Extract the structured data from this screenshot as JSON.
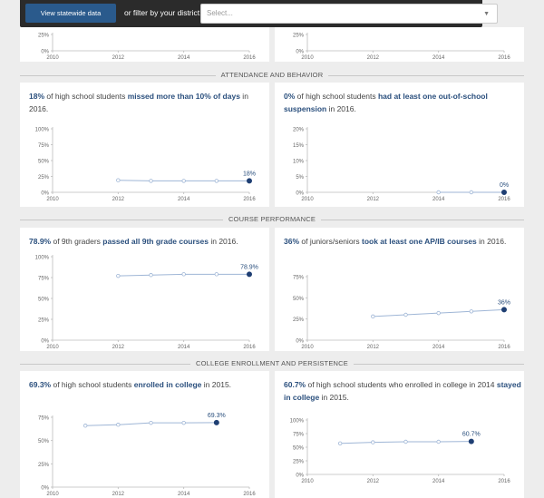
{
  "topbar": {
    "statewide_button": "View statewide data",
    "filter_label": "or filter by your district:",
    "district_placeholder": "Select..."
  },
  "sections": [
    {
      "title": "ATTENDANCE AND BEHAVIOR"
    },
    {
      "title": "COURSE PERFORMANCE"
    },
    {
      "title": "COLLEGE ENROLLMENT AND PERSISTENCE"
    }
  ],
  "cards": [
    {
      "id": "top-left-partial",
      "headline": []
    },
    {
      "id": "top-right-partial",
      "headline": []
    },
    {
      "id": "chronic-absence",
      "headline": [
        {
          "t": "18%",
          "h": true
        },
        {
          "t": " of high school students ",
          "h": false
        },
        {
          "t": "missed more than 10% of days",
          "h": true
        },
        {
          "t": " in 2016.",
          "h": false
        }
      ]
    },
    {
      "id": "suspension",
      "headline": [
        {
          "t": "0%",
          "h": true
        },
        {
          "t": " of high school students ",
          "h": false
        },
        {
          "t": "had at least one out-of-school suspension",
          "h": true
        },
        {
          "t": " in 2016.",
          "h": false
        }
      ]
    },
    {
      "id": "ninth-grade",
      "headline": [
        {
          "t": "78.9%",
          "h": true
        },
        {
          "t": " of 9th graders ",
          "h": false
        },
        {
          "t": "passed all 9th grade courses",
          "h": true
        },
        {
          "t": " in 2016.",
          "h": false
        }
      ]
    },
    {
      "id": "ap-ib",
      "headline": [
        {
          "t": "36%",
          "h": true
        },
        {
          "t": " of juniors/seniors ",
          "h": false
        },
        {
          "t": "took at least one AP/IB courses",
          "h": true
        },
        {
          "t": " in 2016.",
          "h": false
        }
      ]
    },
    {
      "id": "college-enroll",
      "headline": [
        {
          "t": "69.3%",
          "h": true
        },
        {
          "t": " of high school students ",
          "h": false
        },
        {
          "t": "enrolled in college",
          "h": true
        },
        {
          "t": " in 2015.",
          "h": false
        }
      ]
    },
    {
      "id": "college-persist",
      "headline": [
        {
          "t": "60.7%",
          "h": true
        },
        {
          "t": " of high school students who enrolled in college in 2014 ",
          "h": false
        },
        {
          "t": "stayed in college",
          "h": true
        },
        {
          "t": " in 2015.",
          "h": false
        }
      ]
    }
  ],
  "chart_data": [
    {
      "type": "line",
      "x": [],
      "values": [],
      "yticks": [
        "0%",
        "25%"
      ],
      "ylim": [
        0,
        25
      ],
      "xticks": [
        2010,
        2012,
        2014,
        2016
      ],
      "xlim": [
        2010,
        2016
      ],
      "end_label": ""
    },
    {
      "type": "line",
      "x": [],
      "values": [],
      "yticks": [
        "0%",
        "25%"
      ],
      "ylim": [
        0,
        25
      ],
      "xticks": [
        2010,
        2012,
        2014,
        2016
      ],
      "xlim": [
        2010,
        2016
      ],
      "end_label": ""
    },
    {
      "type": "line",
      "x": [
        2012,
        2013,
        2014,
        2015,
        2016
      ],
      "values": [
        19,
        18,
        18,
        18,
        18
      ],
      "yticks": [
        "0%",
        "25%",
        "50%",
        "75%",
        "100%"
      ],
      "ylim": [
        0,
        100
      ],
      "xticks": [
        2010,
        2012,
        2014,
        2016
      ],
      "xlim": [
        2010,
        2016
      ],
      "end_label": "18%"
    },
    {
      "type": "line",
      "x": [
        2014,
        2015,
        2016
      ],
      "values": [
        0,
        0,
        0
      ],
      "yticks": [
        "0%",
        "5%",
        "10%",
        "15%",
        "20%"
      ],
      "ylim": [
        0,
        20
      ],
      "xticks": [
        2010,
        2012,
        2014,
        2016
      ],
      "xlim": [
        2010,
        2016
      ],
      "end_label": "0%"
    },
    {
      "type": "line",
      "x": [
        2012,
        2013,
        2014,
        2015,
        2016
      ],
      "values": [
        77,
        78,
        79,
        79,
        78.9
      ],
      "yticks": [
        "0%",
        "25%",
        "50%",
        "75%",
        "100%"
      ],
      "ylim": [
        0,
        100
      ],
      "xticks": [
        2010,
        2012,
        2014,
        2016
      ],
      "xlim": [
        2010,
        2016
      ],
      "end_label": "78.9%"
    },
    {
      "type": "line",
      "x": [
        2012,
        2013,
        2014,
        2015,
        2016
      ],
      "values": [
        28,
        30,
        32,
        34,
        36
      ],
      "yticks": [
        "0%",
        "25%",
        "50%",
        "75%"
      ],
      "ylim": [
        0,
        75
      ],
      "xticks": [
        2010,
        2012,
        2014,
        2016
      ],
      "xlim": [
        2010,
        2016
      ],
      "end_label": "36%"
    },
    {
      "type": "line",
      "x": [
        2011,
        2012,
        2013,
        2014,
        2015
      ],
      "values": [
        66,
        67,
        69,
        69,
        69.3
      ],
      "yticks": [
        "0%",
        "25%",
        "50%",
        "75%"
      ],
      "ylim": [
        0,
        75
      ],
      "xticks": [
        2010,
        2012,
        2014,
        2016
      ],
      "xlim": [
        2010,
        2016
      ],
      "end_label": "69.3%"
    },
    {
      "type": "line",
      "x": [
        2011,
        2012,
        2013,
        2014,
        2015
      ],
      "values": [
        57,
        59,
        60,
        60,
        60.7
      ],
      "yticks": [
        "0%",
        "25%",
        "50%",
        "75%",
        "100%"
      ],
      "ylim": [
        0,
        100
      ],
      "xticks": [
        2010,
        2012,
        2014,
        2016
      ],
      "xlim": [
        2010,
        2016
      ],
      "end_label": "60.7%"
    }
  ],
  "colors": {
    "line": "#9fb6d6",
    "dot": "#1f3f73",
    "highlight": "#2a4f7d",
    "accent_button": "#2a5a8c"
  }
}
